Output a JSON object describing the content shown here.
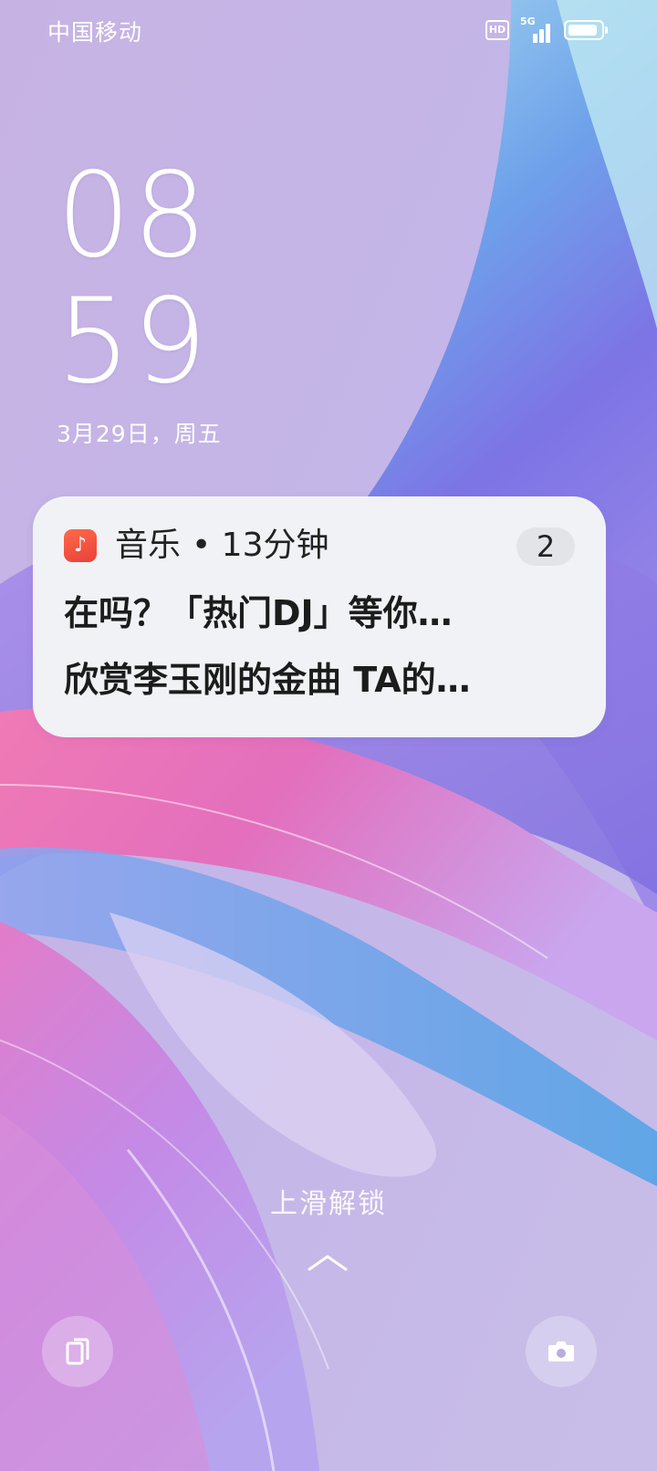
{
  "status_bar": {
    "carrier": "中国移动",
    "hd_label": "HD",
    "network_label": "5G",
    "battery_level": 0.9
  },
  "clock": {
    "hour": "08",
    "minute": "59",
    "date": "3月29日，周五"
  },
  "notification": {
    "app_name": "音乐",
    "time": "• 13分钟",
    "count": "2",
    "line1": "在吗？「热门DJ」等你…",
    "line2": "欣赏李玉刚的金曲 TA的…",
    "app_icon": "music-note-icon",
    "accent_color": "#ea4a3c"
  },
  "unlock": {
    "hint": "上滑解锁",
    "icon": "chevron-up-icon"
  },
  "shortcuts": {
    "left_icon": "wallet-icon",
    "right_icon": "camera-icon"
  }
}
